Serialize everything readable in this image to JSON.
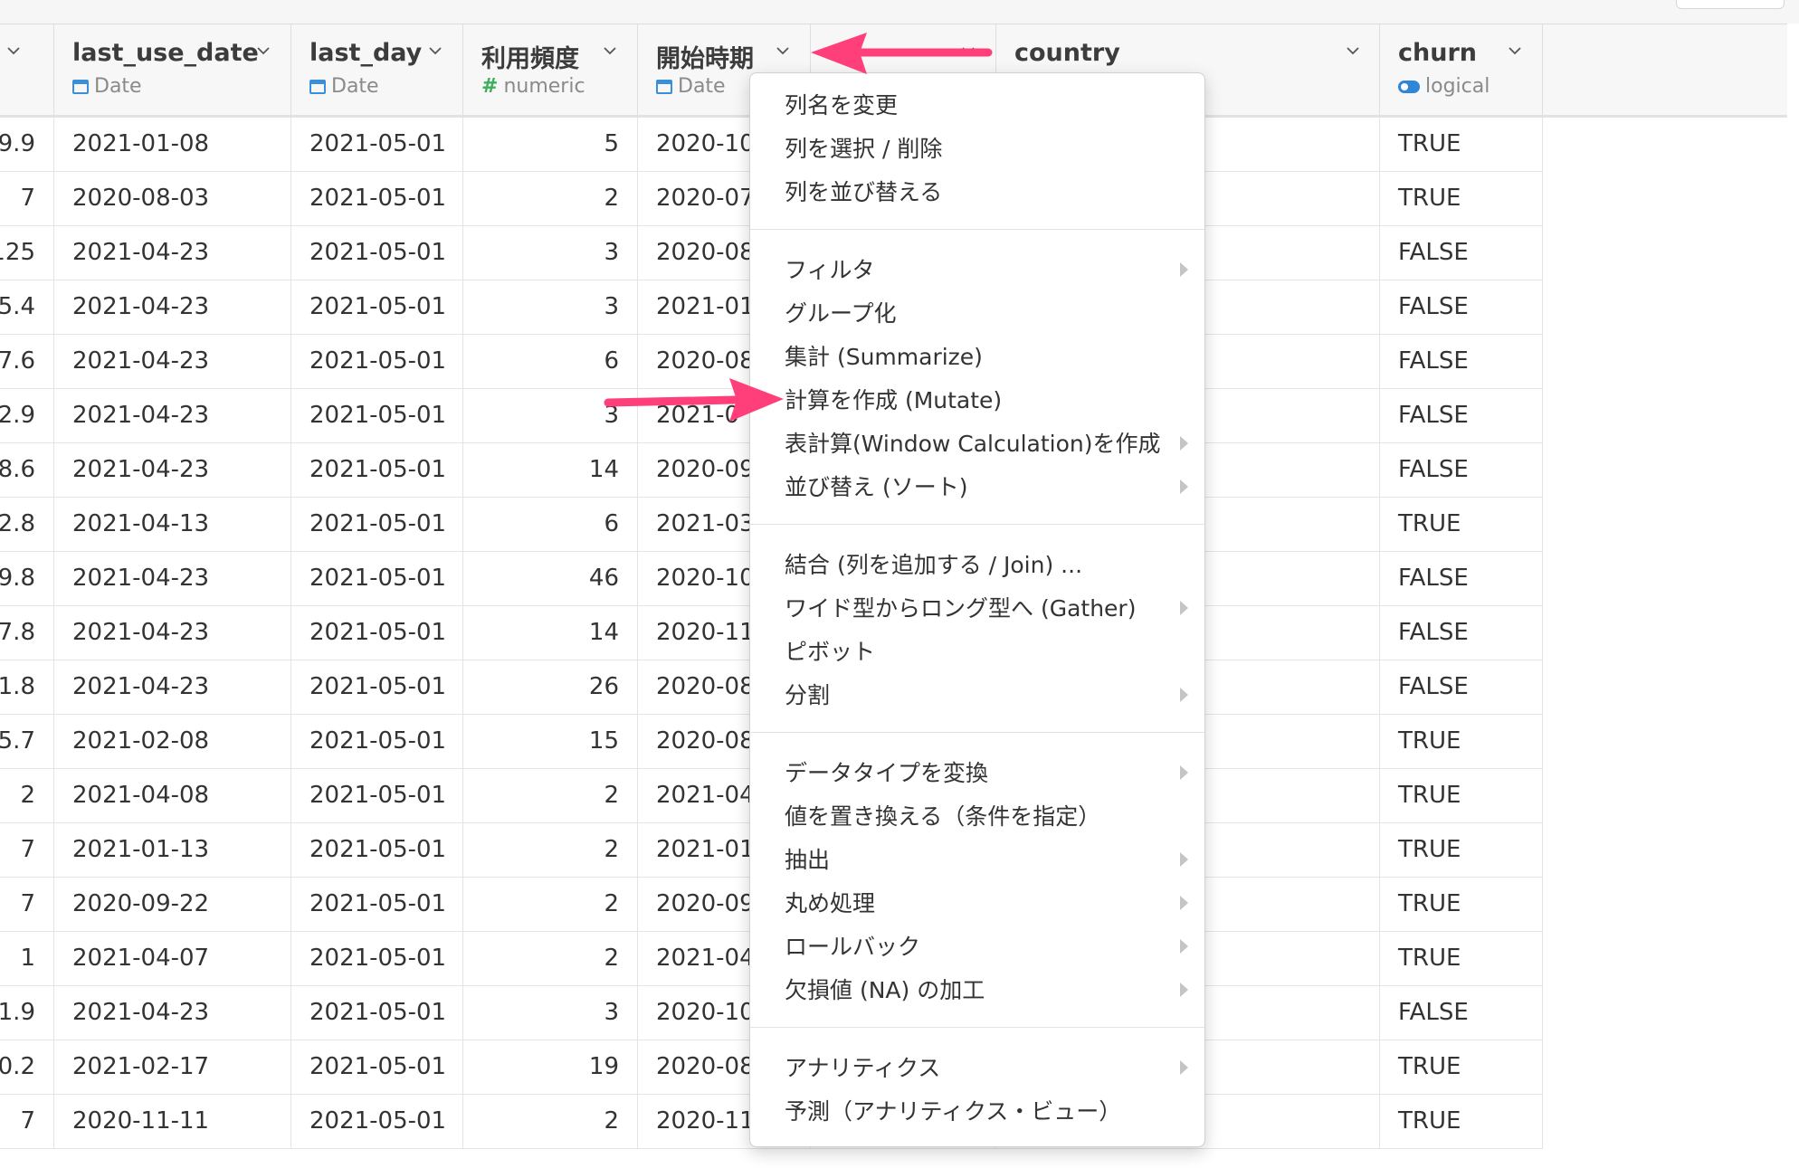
{
  "columns": [
    {
      "name": "",
      "type_label": "",
      "type_icon": ""
    },
    {
      "name": "last_use_date",
      "type_label": "Date",
      "type_icon": "calendar-icon"
    },
    {
      "name": "last_day",
      "type_label": "Date",
      "type_icon": "calendar-icon"
    },
    {
      "name": "利用頻度",
      "type_label": "numeric",
      "type_icon": "hash-icon"
    },
    {
      "name": "開始時期",
      "type_label": "Date",
      "type_icon": "calendar-icon"
    },
    {
      "name": "",
      "type_label": "",
      "type_icon": ""
    },
    {
      "name": "country",
      "type_label": "",
      "type_icon": ""
    },
    {
      "name": "churn",
      "type_label": "logical",
      "type_icon": "toggle-icon"
    }
  ],
  "rows": [
    [
      "9.9",
      "2021-01-08",
      "2021-05-01",
      "5",
      "2020-10",
      "TRUE"
    ],
    [
      "7",
      "2020-08-03",
      "2021-05-01",
      "2",
      "2020-07",
      "TRUE"
    ],
    [
      "125",
      "2021-04-23",
      "2021-05-01",
      "3",
      "2020-08",
      "FALSE"
    ],
    [
      "5.4",
      "2021-04-23",
      "2021-05-01",
      "3",
      "2021-01",
      "FALSE"
    ],
    [
      "7.6",
      "2021-04-23",
      "2021-05-01",
      "6",
      "2020-08",
      "FALSE"
    ],
    [
      "2.9",
      "2021-04-23",
      "2021-05-01",
      "3",
      "2021-0",
      "FALSE"
    ],
    [
      "8.6",
      "2021-04-23",
      "2021-05-01",
      "14",
      "2020-09",
      "FALSE"
    ],
    [
      "2.8",
      "2021-04-13",
      "2021-05-01",
      "6",
      "2021-03",
      "TRUE"
    ],
    [
      "9.8",
      "2021-04-23",
      "2021-05-01",
      "46",
      "2020-10",
      "FALSE"
    ],
    [
      "7.8",
      "2021-04-23",
      "2021-05-01",
      "14",
      "2020-11",
      "FALSE"
    ],
    [
      "1.8",
      "2021-04-23",
      "2021-05-01",
      "26",
      "2020-08",
      "FALSE"
    ],
    [
      "5.7",
      "2021-02-08",
      "2021-05-01",
      "15",
      "2020-08",
      "TRUE"
    ],
    [
      "2",
      "2021-04-08",
      "2021-05-01",
      "2",
      "2021-04",
      "TRUE"
    ],
    [
      "7",
      "2021-01-13",
      "2021-05-01",
      "2",
      "2021-01",
      "TRUE"
    ],
    [
      "7",
      "2020-09-22",
      "2021-05-01",
      "2",
      "2020-09",
      "TRUE"
    ],
    [
      "1",
      "2021-04-07",
      "2021-05-01",
      "2",
      "2021-04",
      "TRUE"
    ],
    [
      "1.9",
      "2021-04-23",
      "2021-05-01",
      "3",
      "2020-10",
      "FALSE"
    ],
    [
      "0.2",
      "2021-02-17",
      "2021-05-01",
      "19",
      "2020-08",
      "TRUE"
    ],
    [
      "7",
      "2020-11-11",
      "2021-05-01",
      "2",
      "2020-11",
      "TRUE"
    ]
  ],
  "menu": {
    "groups": [
      [
        {
          "label": "列名を変更",
          "submenu": false
        },
        {
          "label": "列を選択 / 削除",
          "submenu": false
        },
        {
          "label": "列を並び替える",
          "submenu": false
        }
      ],
      [
        {
          "label": "フィルタ",
          "submenu": true
        },
        {
          "label": "グループ化",
          "submenu": false
        },
        {
          "label": "集計 (Summarize)",
          "submenu": false
        },
        {
          "label": "計算を作成 (Mutate)",
          "submenu": false
        },
        {
          "label": "表計算(Window Calculation)を作成",
          "submenu": true
        },
        {
          "label": "並び替え (ソート)",
          "submenu": true
        }
      ],
      [
        {
          "label": "結合 (列を追加する / Join) ...",
          "submenu": false
        },
        {
          "label": "ワイド型からロング型へ (Gather)",
          "submenu": true
        },
        {
          "label": "ピボット",
          "submenu": false
        },
        {
          "label": "分割",
          "submenu": true
        }
      ],
      [
        {
          "label": "データタイプを変換",
          "submenu": true
        },
        {
          "label": "値を置き換える（条件を指定）",
          "submenu": false
        },
        {
          "label": "抽出",
          "submenu": true
        },
        {
          "label": "丸め処理",
          "submenu": true
        },
        {
          "label": "ロールバック",
          "submenu": true
        },
        {
          "label": "欠損値 (NA) の加工",
          "submenu": true
        }
      ],
      [
        {
          "label": "アナリティクス",
          "submenu": true
        },
        {
          "label": "予測（アナリティクス・ビュー）",
          "submenu": false
        }
      ]
    ]
  },
  "colors": {
    "annotation_arrow": "#ff3f7a",
    "calendar_icon": "#3a8fd8",
    "numeric_icon": "#3cae5c",
    "logical_icon": "#2f86d8"
  }
}
